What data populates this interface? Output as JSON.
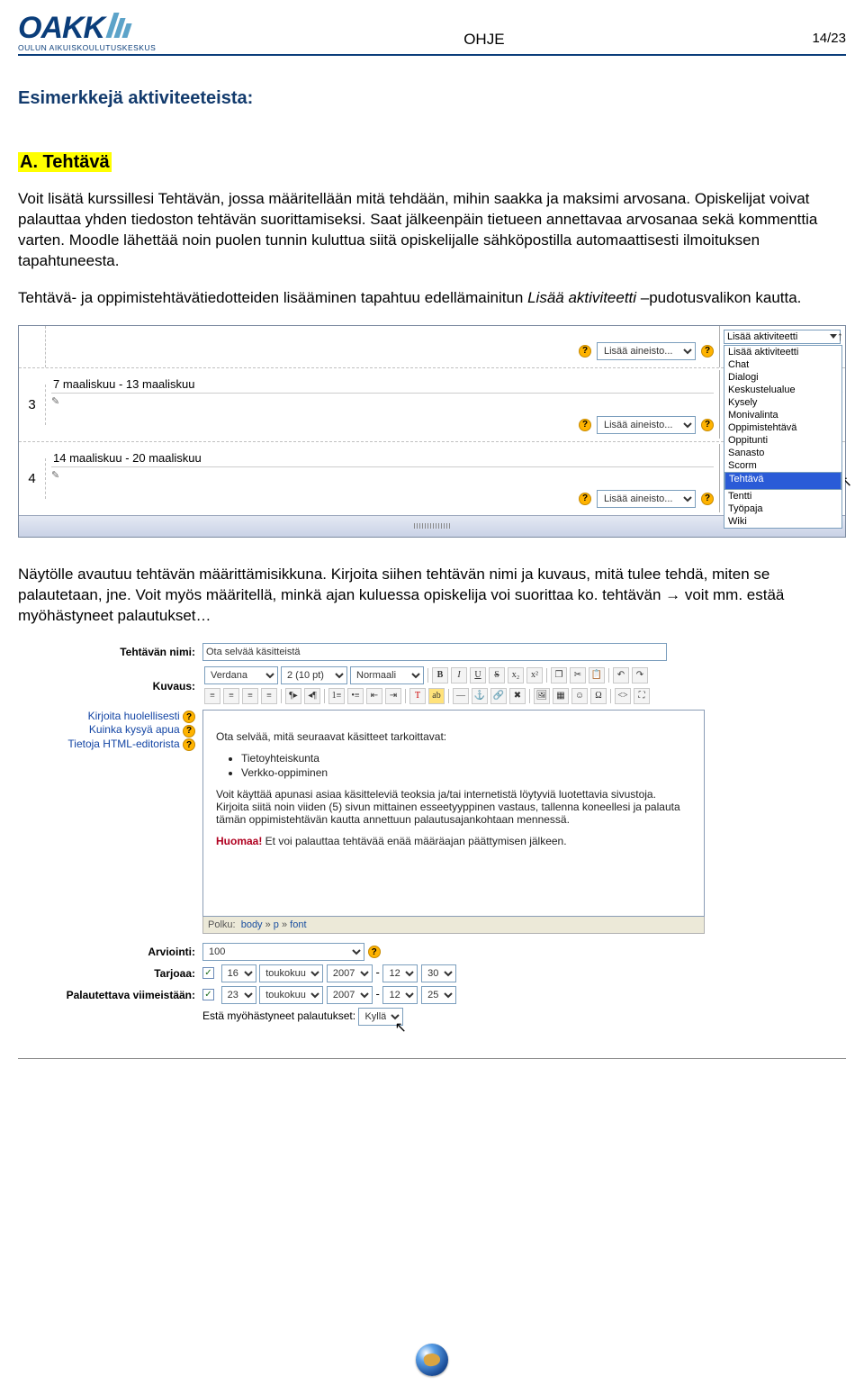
{
  "header": {
    "logo_text": "OAKK",
    "logo_sub": "OULUN AIKUISKOULUTUSKESKUS",
    "doc_title": "OHJE",
    "page_num": "14/23"
  },
  "h_examples": "Esimerkkejä aktiviteeteista:",
  "h_task": "A. Tehtävä",
  "p1": "Voit lisätä kurssillesi Tehtävän, jossa määritellään mitä tehdään, mihin saakka ja maksimi arvosana. Opiskelijat voivat palauttaa yhden tiedoston tehtävän suorittamiseksi. Saat jälkeenpäin tietueen annettavaa arvosanaa sekä kommenttia varten. Moodle lähettää noin puolen tunnin kuluttua siitä opiskelijalle sähköpostilla automaattisesti ilmoituksen tapahtuneesta.",
  "p2_a": "Tehtävä- ja oppimistehtävätiedotteiden lisääminen tapahtuu edellämainitun ",
  "p2_i": "Lisää aktiviteetti",
  "p2_b": " –pudotusvalikon kautta.",
  "shot1": {
    "add_resource": "Lisää aineisto...",
    "add_activity": "Lisää aktiviteetti",
    "row3_num": "3",
    "row3_date": "7 maaliskuu - 13 maaliskuu",
    "row4_num": "4",
    "row4_date": "14 maaliskuu - 20 maaliskuu",
    "activity_options": [
      "Lisää aktiviteetti",
      "Chat",
      "Dialogi",
      "Keskustelualue",
      "Kysely",
      "Monivalinta",
      "Oppimistehtävä",
      "Oppitunti",
      "Sanasto",
      "Scorm",
      "Tehtävä",
      "Tentti",
      "Työpaja",
      "Wiki"
    ],
    "selected": "Tehtävä"
  },
  "p3": "Näytölle avautuu tehtävän määrittämisikkuna. Kirjoita siihen tehtävän nimi ja kuvaus, mitä tulee tehdä, miten se palautetaan, jne. Voit myös määritellä, minkä ajan kuluessa opiskelija voi suorittaa ko. tehtävän → voit mm. estää myöhästyneet palautukset…",
  "shot2": {
    "label_name": "Tehtävän nimi:",
    "name_value": "Ota selvää käsitteistä",
    "label_desc": "Kuvaus:",
    "help1": "Kirjoita huolellisesti",
    "help2": "Kuinka kysyä apua",
    "help3": "Tietoja HTML-editorista",
    "font_family": "Verdana",
    "font_size": "2 (10 pt)",
    "font_style": "Normaali",
    "editor_p1": "Ota selvää, mitä seuraavat käsitteet tarkoittavat:",
    "editor_li1": "Tietoyhteiskunta",
    "editor_li2": "Verkko-oppiminen",
    "editor_p2": "Voit käyttää apunasi asiaa käsitteleviä teoksia ja/tai internetistä löytyviä luotettavia sivustoja. Kirjoita siitä noin viiden (5) sivun mittainen esseetyyppinen vastaus, tallenna koneellesi ja palauta tämän oppimistehtävän kautta annettuun palautusajankohtaan mennessä.",
    "editor_warn_b": "Huomaa!",
    "editor_warn": " Et voi palauttaa tehtävää enää määräajan päättymisen jälkeen.",
    "path_label": "Polku:",
    "path_body": "body",
    "path_p": "p",
    "path_font": "font",
    "label_grade": "Arviointi:",
    "grade_value": "100",
    "label_avail": "Tarjoaa:",
    "avail": {
      "day": "16",
      "month": "toukokuu",
      "year": "2007",
      "hour": "12",
      "min": "30"
    },
    "label_due": "Palautettava viimeistään:",
    "due": {
      "day": "23",
      "month": "toukokuu",
      "year": "2007",
      "hour": "12",
      "min": "25"
    },
    "label_prevent": "Estä myöhästyneet palautukset:",
    "prevent_value": "Kyllä",
    "sep": " - "
  }
}
